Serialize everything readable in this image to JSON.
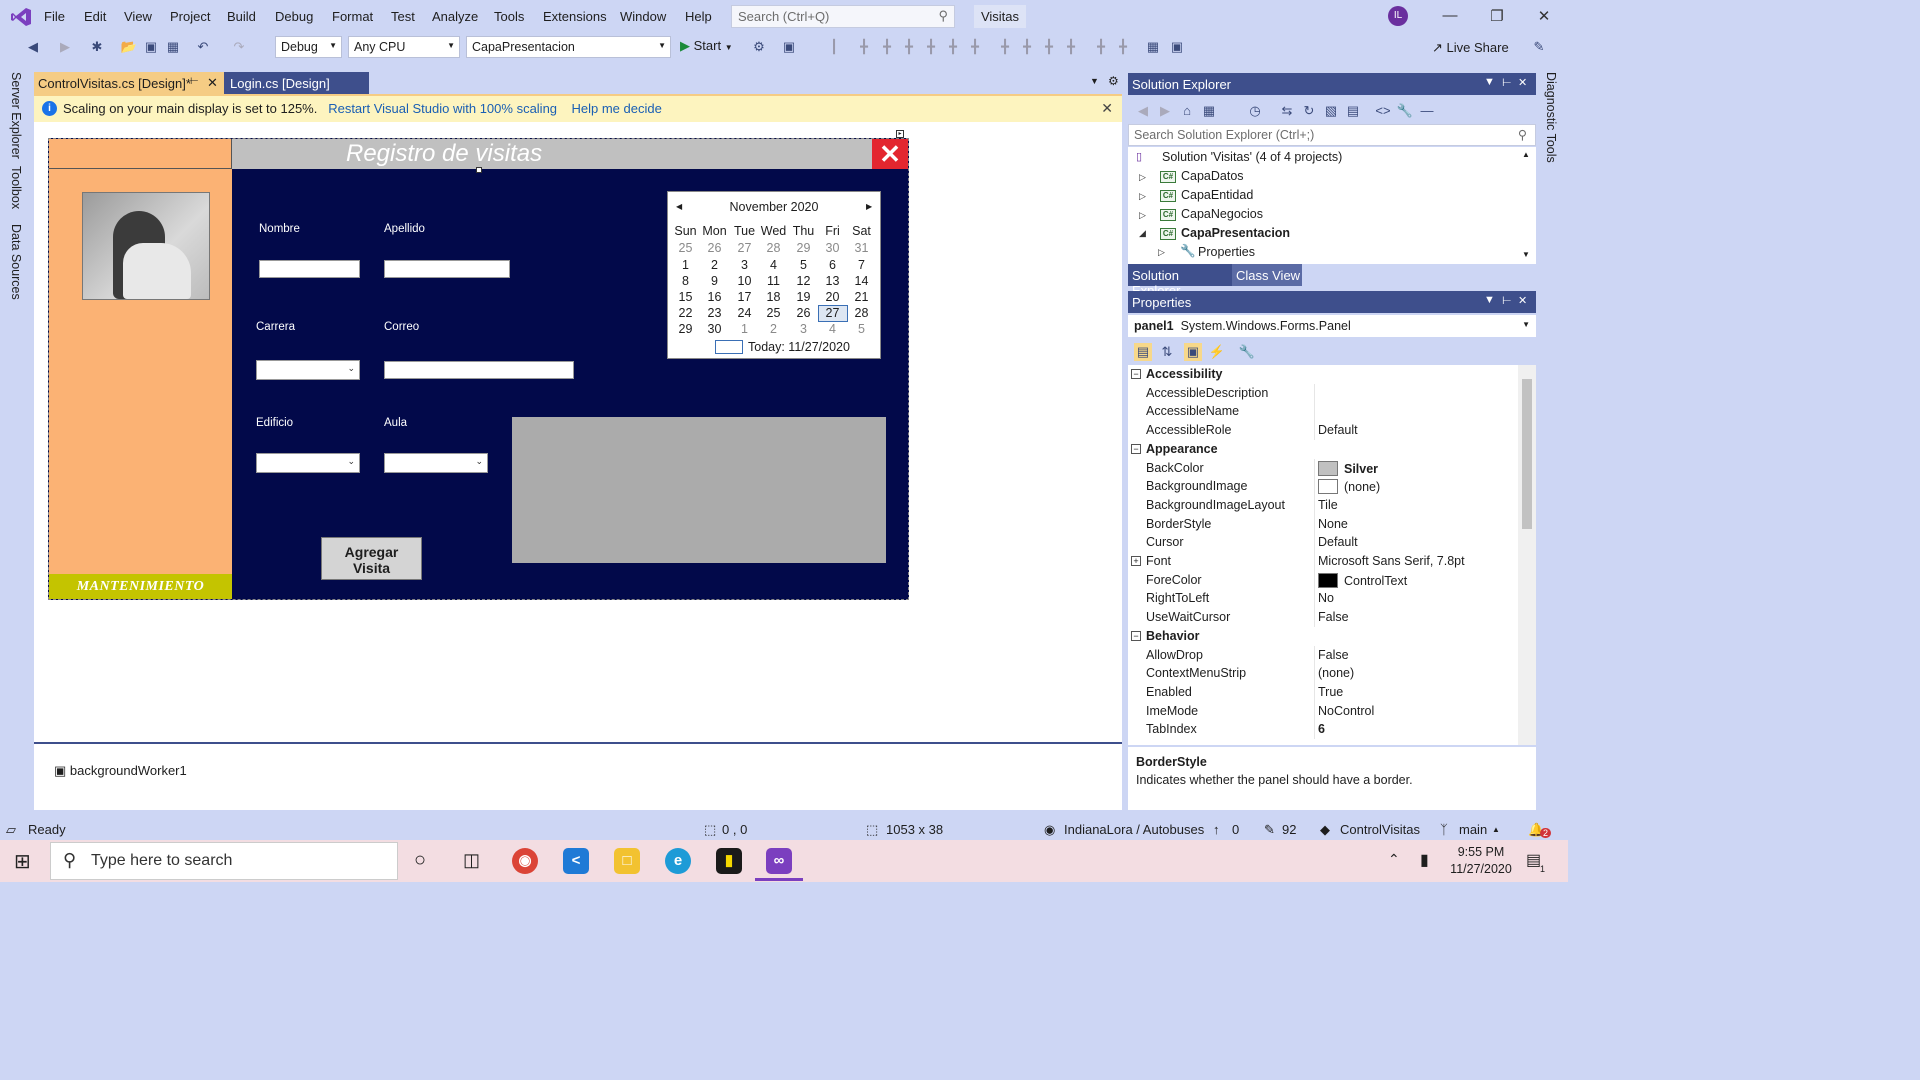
{
  "menu": {
    "items": [
      "File",
      "Edit",
      "View",
      "Project",
      "Build",
      "Debug",
      "Format",
      "Test",
      "Analyze",
      "Tools",
      "Extensions",
      "Window",
      "Help"
    ],
    "search_placeholder": "Search (Ctrl+Q)",
    "solution_name": "Visitas",
    "user_initials": "IL"
  },
  "toolbar": {
    "config": "Debug",
    "platform": "Any CPU",
    "startup_project": "CapaPresentacion",
    "start_label": "Start",
    "live_share": "Live Share"
  },
  "side_tabs": [
    "Server Explorer",
    "Toolbox",
    "Data Sources"
  ],
  "right_side_tab": "Diagnostic Tools",
  "doc_tabs": {
    "active": "ControlVisitas.cs [Design]*",
    "inactive": "Login.cs [Design]"
  },
  "infobar": {
    "message": "Scaling on your main display is set to 125%.",
    "link1": "Restart Visual Studio with 100% scaling",
    "link2": "Help me decide"
  },
  "form": {
    "title": "Registro de visitas",
    "mantenimiento": "MANTENIMIENTO",
    "labels": {
      "nombre": "Nombre",
      "apellido": "Apellido",
      "carrera": "Carrera",
      "correo": "Correo",
      "edificio": "Edificio",
      "aula": "Aula"
    },
    "agregar_line1": "Agregar",
    "agregar_line2": "Visita"
  },
  "calendar": {
    "month": "November 2020",
    "day_names": [
      "Sun",
      "Mon",
      "Tue",
      "Wed",
      "Thu",
      "Fri",
      "Sat"
    ],
    "weeks": [
      [
        "25",
        "26",
        "27",
        "28",
        "29",
        "30",
        "31"
      ],
      [
        "1",
        "2",
        "3",
        "4",
        "5",
        "6",
        "7"
      ],
      [
        "8",
        "9",
        "10",
        "11",
        "12",
        "13",
        "14"
      ],
      [
        "15",
        "16",
        "17",
        "18",
        "19",
        "20",
        "21"
      ],
      [
        "22",
        "23",
        "24",
        "25",
        "26",
        "27",
        "28"
      ],
      [
        "29",
        "30",
        "1",
        "2",
        "3",
        "4",
        "5"
      ]
    ],
    "selected": "27",
    "today": "Today: 11/27/2020"
  },
  "tray": {
    "component": "backgroundWorker1"
  },
  "solution_explorer": {
    "title": "Solution Explorer",
    "search_placeholder": "Search Solution Explorer (Ctrl+;)",
    "solution": "Solution 'Visitas' (4 of 4 projects)",
    "projects": [
      "CapaDatos",
      "CapaEntidad",
      "CapaNegocios",
      "CapaPresentacion"
    ],
    "child": "Properties",
    "tab_active": "Solution Explorer",
    "tab_other": "Class View"
  },
  "properties": {
    "title": "Properties",
    "object": "panel1",
    "object_type": "System.Windows.Forms.Panel",
    "rows": [
      {
        "cat": true,
        "name": "Accessibility"
      },
      {
        "name": "AccessibleDescription",
        "value": ""
      },
      {
        "name": "AccessibleName",
        "value": ""
      },
      {
        "name": "AccessibleRole",
        "value": "Default"
      },
      {
        "cat": true,
        "name": "Appearance"
      },
      {
        "name": "BackColor",
        "value": "Silver",
        "swatch": "#c0c0c0",
        "bold": true
      },
      {
        "name": "BackgroundImage",
        "value": "(none)",
        "swatch": "#ffffff"
      },
      {
        "name": "BackgroundImageLayout",
        "value": "Tile"
      },
      {
        "name": "BorderStyle",
        "value": "None"
      },
      {
        "name": "Cursor",
        "value": "Default"
      },
      {
        "name": "Font",
        "value": "Microsoft Sans Serif, 7.8pt",
        "expand": true
      },
      {
        "name": "ForeColor",
        "value": "ControlText",
        "swatch": "#000000"
      },
      {
        "name": "RightToLeft",
        "value": "No"
      },
      {
        "name": "UseWaitCursor",
        "value": "False"
      },
      {
        "cat": true,
        "name": "Behavior"
      },
      {
        "name": "AllowDrop",
        "value": "False"
      },
      {
        "name": "ContextMenuStrip",
        "value": "(none)"
      },
      {
        "name": "Enabled",
        "value": "True"
      },
      {
        "name": "ImeMode",
        "value": "NoControl"
      },
      {
        "name": "TabIndex",
        "value": "6",
        "bold": true
      }
    ],
    "desc_title": "BorderStyle",
    "desc_text": "Indicates whether the panel should have a border."
  },
  "statusbar": {
    "ready": "Ready",
    "position": "0 , 0",
    "size": "1053 x 38",
    "repo": "IndianaLora / Autobuses",
    "push": "0",
    "changes": "92",
    "project": "ControlVisitas",
    "branch": "main",
    "notifications": "2"
  },
  "taskbar": {
    "search_placeholder": "Type here to search",
    "time": "9:55 PM",
    "date": "11/27/2020",
    "notif_count": "1"
  },
  "colors": {
    "chrome": "#cdd6f4",
    "panel_title": "#3e4f8c",
    "form_bg": "#02094a",
    "form_left": "#fbb274",
    "mant": "#c4c400",
    "close_red": "#e3262f"
  }
}
